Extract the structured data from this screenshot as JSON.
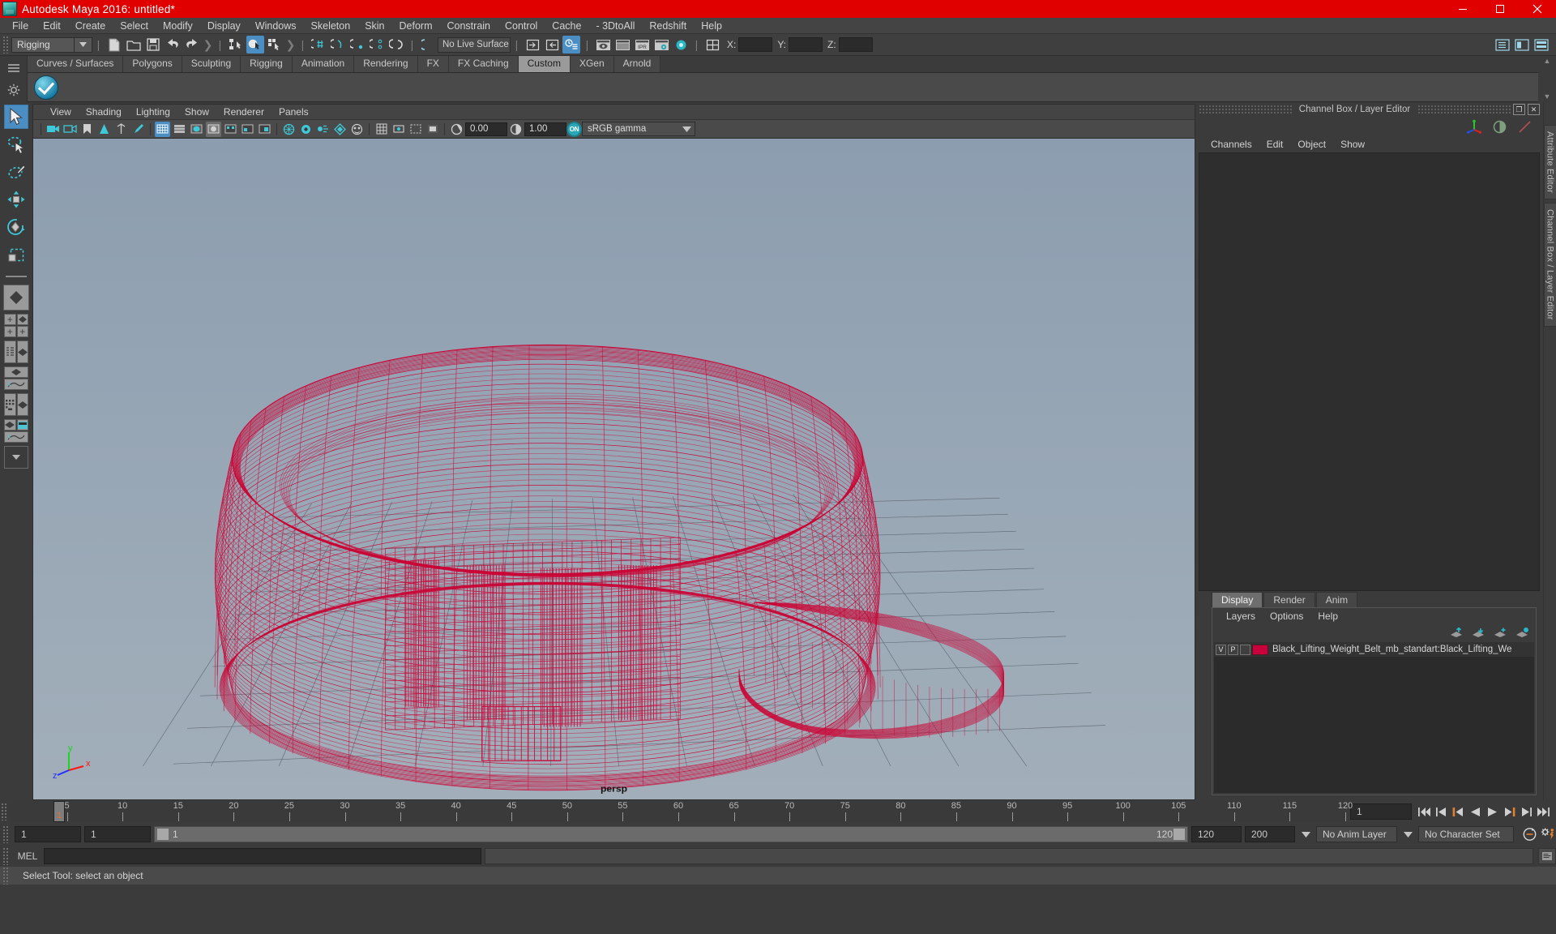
{
  "window": {
    "title": "Autodesk Maya 2016: untitled*",
    "app_icon": "maya-icon",
    "minimize": "–",
    "maximize": "❐",
    "close": "✕",
    "accent_red": "#e00000"
  },
  "menubar": {
    "items": [
      "File",
      "Edit",
      "Create",
      "Select",
      "Modify",
      "Display",
      "Windows",
      "Skeleton",
      "Skin",
      "Deform",
      "Constrain",
      "Control",
      "Cache",
      "- 3DtoAll",
      "Redshift",
      "Help"
    ]
  },
  "statusline": {
    "menu_set": "Rigging",
    "live_surface": "No Live Surface",
    "x_label": "X:",
    "y_label": "Y:",
    "z_label": "Z:",
    "x_value": "",
    "y_value": "",
    "z_value": ""
  },
  "shelf": {
    "tabs": [
      "Curves / Surfaces",
      "Polygons",
      "Sculpting",
      "Rigging",
      "Animation",
      "Rendering",
      "FX",
      "FX Caching",
      "Custom",
      "XGen",
      "Arnold"
    ],
    "active_tab": "Custom",
    "button_icon": "checkmark-badge-icon"
  },
  "viewport_panel": {
    "menu": [
      "View",
      "Shading",
      "Lighting",
      "Show",
      "Renderer",
      "Panels"
    ],
    "exposure_value": "0.00",
    "gamma_value": "1.00",
    "color_management_toggle": "ON",
    "color_profile": "sRGB gamma",
    "camera_label": "persp",
    "axes": {
      "x": "x",
      "y": "y",
      "z": "z",
      "x_color": "#ff2222",
      "y_color": "#22dd22",
      "z_color": "#3344ff"
    },
    "wireframe_color": "#cc0033",
    "background_top": "#8e9fb0",
    "background_bottom": "#a0adb8"
  },
  "right_dock": {
    "panel_title": "Channel Box / Layer Editor",
    "restore_glyph": "❐",
    "close_glyph": "✕",
    "channel_menu": [
      "Channels",
      "Edit",
      "Object",
      "Show"
    ],
    "vertical_tabs": [
      "Attribute Editor",
      "Channel Box / Layer Editor"
    ],
    "layer_editor": {
      "tabs": [
        "Display",
        "Render",
        "Anim"
      ],
      "active_tab": "Display",
      "menu": [
        "Layers",
        "Options",
        "Help"
      ],
      "layers": [
        {
          "visibility": "V",
          "playback": "P",
          "reference": "",
          "color": "#c8003c",
          "name": "Black_Lifting_Weight_Belt_mb_standart:Black_Lifting_We"
        }
      ]
    }
  },
  "time_slider": {
    "ticks": [
      {
        "label": "5",
        "frame": 5
      },
      {
        "label": "10",
        "frame": 10
      },
      {
        "label": "15",
        "frame": 15
      },
      {
        "label": "20",
        "frame": 20
      },
      {
        "label": "25",
        "frame": 25
      },
      {
        "label": "30",
        "frame": 30
      },
      {
        "label": "35",
        "frame": 35
      },
      {
        "label": "40",
        "frame": 40
      },
      {
        "label": "45",
        "frame": 45
      },
      {
        "label": "50",
        "frame": 50
      },
      {
        "label": "55",
        "frame": 55
      },
      {
        "label": "60",
        "frame": 60
      },
      {
        "label": "65",
        "frame": 65
      },
      {
        "label": "70",
        "frame": 70
      },
      {
        "label": "75",
        "frame": 75
      },
      {
        "label": "80",
        "frame": 80
      },
      {
        "label": "85",
        "frame": 85
      },
      {
        "label": "90",
        "frame": 90
      },
      {
        "label": "95",
        "frame": 95
      },
      {
        "label": "100",
        "frame": 100
      },
      {
        "label": "105",
        "frame": 105
      },
      {
        "label": "110",
        "frame": 110
      },
      {
        "label": "115",
        "frame": 115
      },
      {
        "label": "120",
        "frame": 120
      }
    ],
    "current_frame_marker": "1",
    "current_frame_field": "1",
    "range_start": 1,
    "range_end": 120,
    "playback_buttons": [
      "go-to-start-icon",
      "step-back-keyframe-icon",
      "step-back-frame-icon",
      "play-backwards-icon",
      "play-forwards-icon",
      "step-forward-frame-icon",
      "step-forward-keyframe-icon",
      "go-to-end-icon"
    ]
  },
  "range_slider": {
    "anim_start": "1",
    "range_start": "1",
    "range_bar_label": "1",
    "range_bar_end_label": "120",
    "range_end": "120",
    "anim_end": "200",
    "anim_layer": "No Anim Layer",
    "character_set": "No Character Set",
    "auto_key_icon": "auto-keyframe-icon",
    "anim_prefs_icon": "animation-preferences-icon"
  },
  "command_line": {
    "language_label": "MEL",
    "input_value": "",
    "output_value": ""
  },
  "help_line": {
    "text": "Select Tool: select an object"
  },
  "toolbox": {
    "tools": [
      {
        "name": "select-tool",
        "selected": true
      },
      {
        "name": "lasso-select-tool",
        "selected": false
      },
      {
        "name": "paint-select-tool",
        "selected": false
      },
      {
        "name": "move-tool",
        "selected": false
      },
      {
        "name": "rotate-tool",
        "selected": false
      },
      {
        "name": "scale-tool",
        "selected": false
      },
      {
        "name": "last-tool-used",
        "selected": false
      }
    ],
    "layout_presets": [
      "single-perspective-view",
      "four-view-layout",
      "outliner-persp-layout",
      "persp-graph-layout",
      "hypershade-persp-layout",
      "persp-graph-outliner-layout",
      "layout-dropdown"
    ]
  }
}
